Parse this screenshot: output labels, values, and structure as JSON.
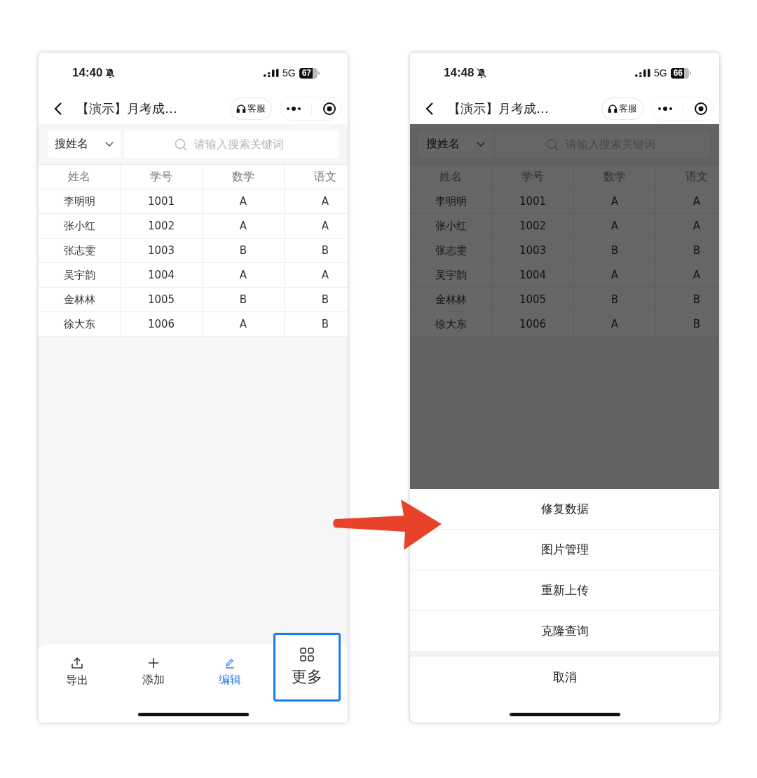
{
  "phones": [
    {
      "dimmed": false,
      "status_bar": {
        "time": "14:40",
        "network": "5G",
        "battery": "67"
      },
      "nav": {
        "title": "【演示】月考成…",
        "service_button": "客服"
      },
      "filter": {
        "dropdown": "搜姓名",
        "search": {
          "placeholder": "请输入搜索关键词"
        }
      },
      "table": {
        "columns": [
          "姓名",
          "学号",
          "数学",
          "语文"
        ],
        "rows": [
          [
            "李明明",
            "1001",
            "A",
            "A"
          ],
          [
            "张小红",
            "1002",
            "A",
            "A"
          ],
          [
            "张志雯",
            "1003",
            "B",
            "B"
          ],
          [
            "吴宇韵",
            "1004",
            "A",
            "A"
          ],
          [
            "金林林",
            "1005",
            "B",
            "B"
          ],
          [
            "徐大东",
            "1006",
            "A",
            "B"
          ]
        ]
      },
      "toolbar": [
        {
          "kind": "export",
          "label": "导出",
          "color": "#333333",
          "highlighted": false
        },
        {
          "kind": "add",
          "label": "添加",
          "color": "#333333",
          "highlighted": false
        },
        {
          "kind": "edit",
          "label": "编辑",
          "color": "#2b7ff5",
          "highlighted": false
        },
        {
          "kind": "more",
          "label": "更多",
          "color": "#333333",
          "highlighted": true
        }
      ]
    },
    {
      "dimmed": true,
      "status_bar": {
        "time": "14:48",
        "network": "5G",
        "battery": "66"
      },
      "nav": {
        "title": "【演示】月考成…",
        "service_button": "客服"
      },
      "filter": {
        "dropdown": "搜姓名",
        "search": {
          "placeholder": "请输入搜索关键词"
        }
      },
      "table": {
        "columns": [
          "姓名",
          "学号",
          "数学",
          "语文"
        ],
        "rows": [
          [
            "李明明",
            "1001",
            "A",
            "A"
          ],
          [
            "张小红",
            "1002",
            "A",
            "A"
          ],
          [
            "张志雯",
            "1003",
            "B",
            "B"
          ],
          [
            "吴宇韵",
            "1004",
            "A",
            "A"
          ],
          [
            "金林林",
            "1005",
            "B",
            "B"
          ],
          [
            "徐大东",
            "1006",
            "A",
            "B"
          ]
        ]
      },
      "action_sheet": {
        "items": [
          "修复数据",
          "图片管理",
          "重新上传",
          "克隆查询"
        ],
        "cancel": "取消"
      }
    }
  ]
}
